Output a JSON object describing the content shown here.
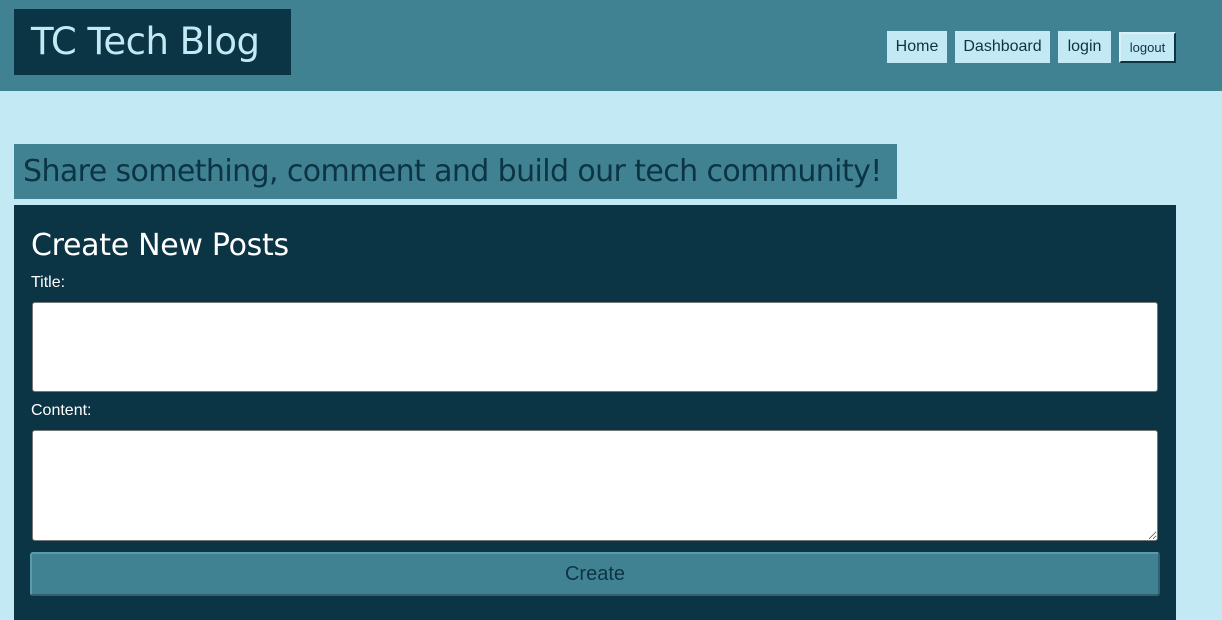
{
  "header": {
    "brand": "TC Tech Blog",
    "nav": {
      "home": "Home",
      "dashboard": "Dashboard",
      "login": "login",
      "logout": "logout"
    }
  },
  "tagline": "Share something, comment and build our tech community!",
  "form": {
    "heading": "Create New Posts",
    "title_label": "Title:",
    "title_value": "",
    "content_label": "Content:",
    "content_value": "",
    "submit_label": "Create"
  },
  "colors": {
    "background": "#c3eaf4",
    "header": "#418292",
    "dark": "#0b3444",
    "accent_text": "#c3eaf4"
  }
}
